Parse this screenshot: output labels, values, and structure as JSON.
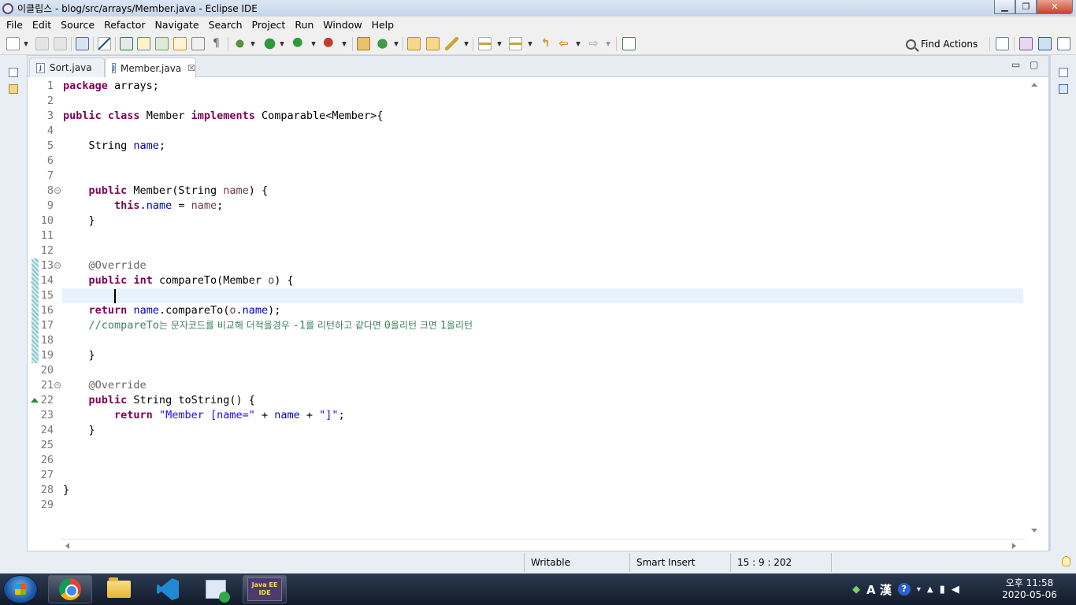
{
  "window": {
    "title": "이클립스 - blog/src/arrays/Member.java - Eclipse IDE",
    "minimize": "▁",
    "maximize": "❐",
    "close": "✕"
  },
  "menu": [
    "File",
    "Edit",
    "Source",
    "Refactor",
    "Navigate",
    "Search",
    "Project",
    "Run",
    "Window",
    "Help"
  ],
  "toolbar": {
    "find_actions": "Find Actions"
  },
  "editor": {
    "tabs": [
      {
        "label": "Sort.java",
        "active": false
      },
      {
        "label": "Member.java",
        "active": true,
        "close": "☒"
      }
    ],
    "minimize": "▭",
    "maximize": "▢",
    "current_line": 15,
    "lines": [
      {
        "n": "1",
        "tokens": [
          {
            "t": "package",
            "c": "kw"
          },
          {
            "t": " arrays;"
          }
        ]
      },
      {
        "n": "2",
        "tokens": []
      },
      {
        "n": "3",
        "tokens": [
          {
            "t": "public",
            "c": "kw"
          },
          {
            "t": " "
          },
          {
            "t": "class",
            "c": "kw"
          },
          {
            "t": " Member "
          },
          {
            "t": "implements",
            "c": "kw"
          },
          {
            "t": " Comparable<Member>{"
          }
        ]
      },
      {
        "n": "4",
        "tokens": []
      },
      {
        "n": "5",
        "tokens": [
          {
            "t": "    String "
          },
          {
            "t": "name",
            "c": "fld"
          },
          {
            "t": ";"
          }
        ]
      },
      {
        "n": "6",
        "tokens": []
      },
      {
        "n": "7",
        "tokens": []
      },
      {
        "n": "8",
        "fold": true,
        "tokens": [
          {
            "t": "    "
          },
          {
            "t": "public",
            "c": "kw"
          },
          {
            "t": " Member(String "
          },
          {
            "t": "name",
            "c": "par"
          },
          {
            "t": ") {"
          }
        ]
      },
      {
        "n": "9",
        "tokens": [
          {
            "t": "        "
          },
          {
            "t": "this",
            "c": "kw"
          },
          {
            "t": "."
          },
          {
            "t": "name",
            "c": "fld"
          },
          {
            "t": " = "
          },
          {
            "t": "name",
            "c": "par"
          },
          {
            "t": ";"
          }
        ]
      },
      {
        "n": "10",
        "tokens": [
          {
            "t": "    }"
          }
        ]
      },
      {
        "n": "11",
        "tokens": []
      },
      {
        "n": "12",
        "tokens": []
      },
      {
        "n": "13",
        "fold": true,
        "changed": true,
        "tokens": [
          {
            "t": "    "
          },
          {
            "t": "@Override",
            "c": "ann"
          }
        ]
      },
      {
        "n": "14",
        "override": true,
        "changed": true,
        "tokens": [
          {
            "t": "    "
          },
          {
            "t": "public",
            "c": "kw"
          },
          {
            "t": " "
          },
          {
            "t": "int",
            "c": "kw"
          },
          {
            "t": " compareTo(Member "
          },
          {
            "t": "o",
            "c": "par"
          },
          {
            "t": ") {"
          }
        ]
      },
      {
        "n": "15",
        "changed": true,
        "tokens": []
      },
      {
        "n": "16",
        "changed": true,
        "tokens": [
          {
            "t": "    "
          },
          {
            "t": "return",
            "c": "kw"
          },
          {
            "t": " "
          },
          {
            "t": "name",
            "c": "fld"
          },
          {
            "t": ".compareTo("
          },
          {
            "t": "o",
            "c": "par"
          },
          {
            "t": "."
          },
          {
            "t": "name",
            "c": "fld"
          },
          {
            "t": ");"
          }
        ]
      },
      {
        "n": "17",
        "changed": true,
        "tokens": [
          {
            "t": "    //compareTo",
            "c": "cmt"
          },
          {
            "t": "는 문자코드를 비교해 더적을경우 ",
            "c": "cmt cmt-kr"
          },
          {
            "t": "-1",
            "c": "cmt"
          },
          {
            "t": "를 리턴하고 같다면 ",
            "c": "cmt cmt-kr"
          },
          {
            "t": "0",
            "c": "cmt"
          },
          {
            "t": "을리턴 크면 ",
            "c": "cmt cmt-kr"
          },
          {
            "t": "1",
            "c": "cmt"
          },
          {
            "t": "을리턴",
            "c": "cmt cmt-kr"
          }
        ]
      },
      {
        "n": "18",
        "changed": true,
        "tokens": []
      },
      {
        "n": "19",
        "changed": true,
        "tokens": [
          {
            "t": "    }"
          }
        ]
      },
      {
        "n": "20",
        "tokens": []
      },
      {
        "n": "21",
        "fold": true,
        "tokens": [
          {
            "t": "    "
          },
          {
            "t": "@Override",
            "c": "ann"
          }
        ]
      },
      {
        "n": "22",
        "override": true,
        "tokens": [
          {
            "t": "    "
          },
          {
            "t": "public",
            "c": "kw"
          },
          {
            "t": " String toString() {"
          }
        ]
      },
      {
        "n": "23",
        "tokens": [
          {
            "t": "        "
          },
          {
            "t": "return",
            "c": "kw"
          },
          {
            "t": " "
          },
          {
            "t": "\"Member [name=\"",
            "c": "str"
          },
          {
            "t": " + "
          },
          {
            "t": "name",
            "c": "fld"
          },
          {
            "t": " + "
          },
          {
            "t": "\"]\"",
            "c": "str"
          },
          {
            "t": ";"
          }
        ]
      },
      {
        "n": "24",
        "tokens": [
          {
            "t": "    }"
          }
        ]
      },
      {
        "n": "25",
        "tokens": []
      },
      {
        "n": "26",
        "tokens": []
      },
      {
        "n": "27",
        "tokens": []
      },
      {
        "n": "28",
        "tokens": [
          {
            "t": "}"
          }
        ]
      },
      {
        "n": "29",
        "tokens": []
      }
    ]
  },
  "status": {
    "writable": "Writable",
    "insert_mode": "Smart Insert",
    "position": "15 : 9 : 202"
  },
  "taskbar": {
    "eclipse_label": "Java EE IDE",
    "tray_lang": "A 漢",
    "tray_help": "?",
    "clock_period_time": "오후 11:58",
    "clock_date": "2020-05-06"
  },
  "colors": {
    "keyword": "#7f0055",
    "field": "#0000c0",
    "string": "#2a00ff",
    "comment": "#3f7f5f",
    "annotation": "#646464",
    "current_line": "#e8f2fe"
  }
}
